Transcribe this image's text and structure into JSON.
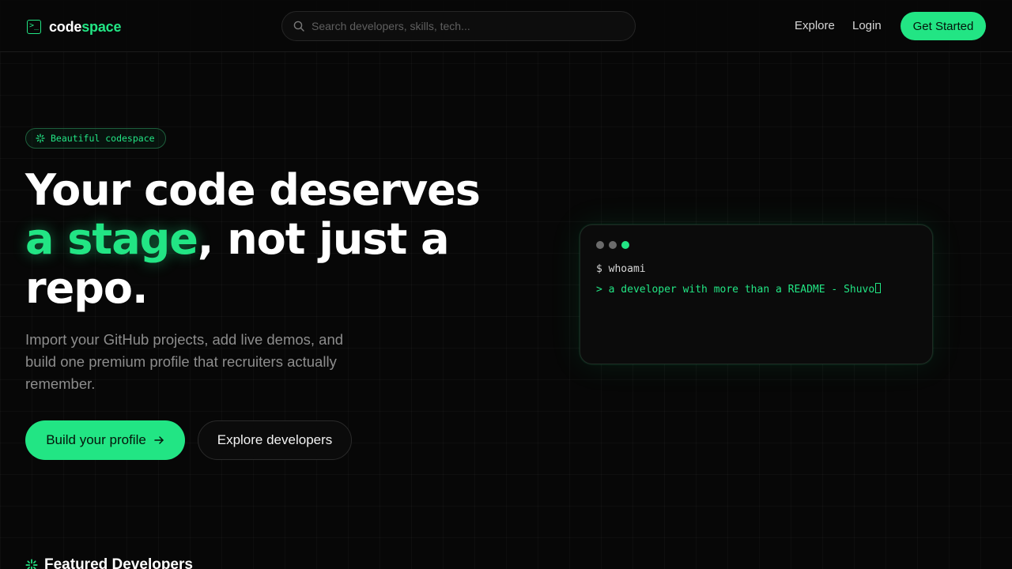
{
  "header": {
    "brand_prefix": "code",
    "brand_suffix": "space",
    "search_placeholder": "Search developers, skills, tech...",
    "nav": {
      "explore": "Explore",
      "login": "Login",
      "get_started": "Get Started"
    }
  },
  "hero": {
    "badge": "Beautiful codespace",
    "title_line1": "Your code deserves",
    "title_accent": "a stage",
    "title_rest": ", not just a",
    "title_line3": "repo.",
    "subtitle": "Import your GitHub projects, add live demos, and build one premium profile that recruiters actually remember.",
    "primary_cta": "Build your profile",
    "secondary_cta": "Explore developers"
  },
  "terminal": {
    "command": "$ whoami",
    "output": "> a developer with more than a README - Shuvo"
  },
  "featured": {
    "title": "Featured Developers"
  },
  "colors": {
    "accent": "#22e584",
    "background": "#070707",
    "muted_text": "#8d8d8d"
  },
  "icons": [
    "terminal-icon",
    "search-icon",
    "sparkle-icon",
    "arrow-right-icon"
  ]
}
